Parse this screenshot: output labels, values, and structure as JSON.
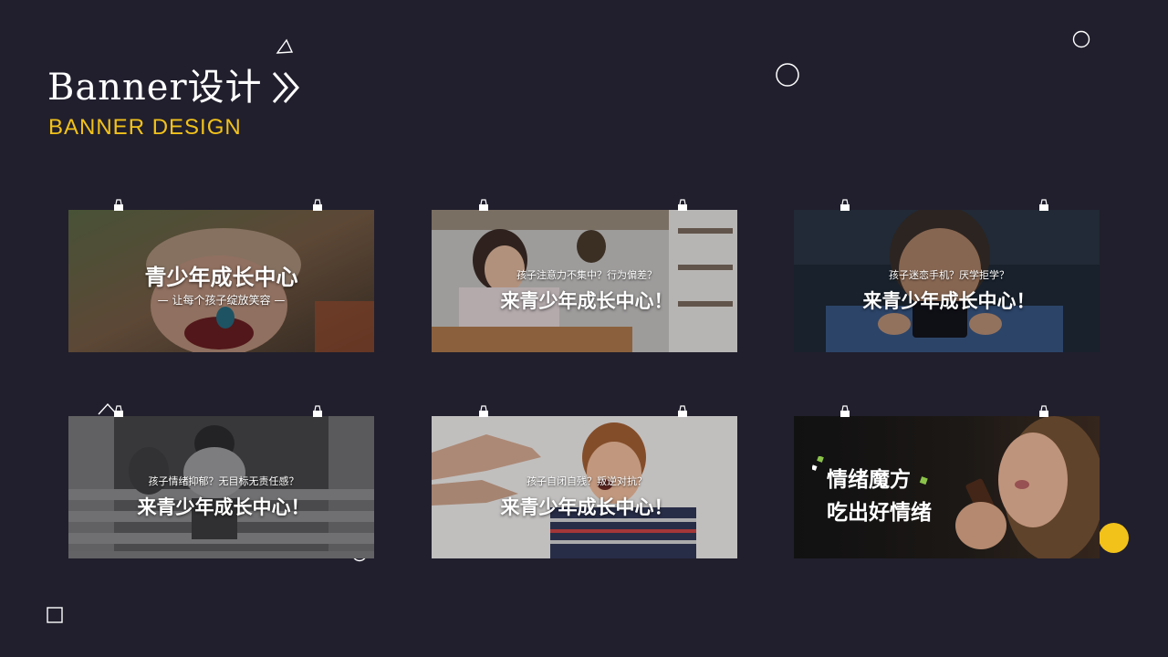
{
  "header": {
    "title": "Banner设计",
    "subtitle": "BANNER DESIGN",
    "chevron_icon": "double-chevron-right-icon"
  },
  "colors": {
    "background": "#211f2d",
    "accent_yellow": "#f2c21a",
    "white": "#ffffff",
    "green": "#8bc34a"
  },
  "banners": [
    {
      "main": "青少年成长中心",
      "sub": "让每个孩子绽放笑容"
    },
    {
      "question": "孩子注意力不集中？行为偏差？",
      "main": "来青少年成长中心！"
    },
    {
      "question": "孩子迷恋手机？厌学拒学？",
      "main": "来青少年成长中心！"
    },
    {
      "question": "孩子情绪抑郁？无目标无责任感？",
      "main": "来青少年成长中心！"
    },
    {
      "question": "孩子自闭自残？叛逆对抗？",
      "main": "来青少年成长中心！"
    },
    {
      "line1": "情绪魔方",
      "line2": "吃出好情绪"
    }
  ]
}
